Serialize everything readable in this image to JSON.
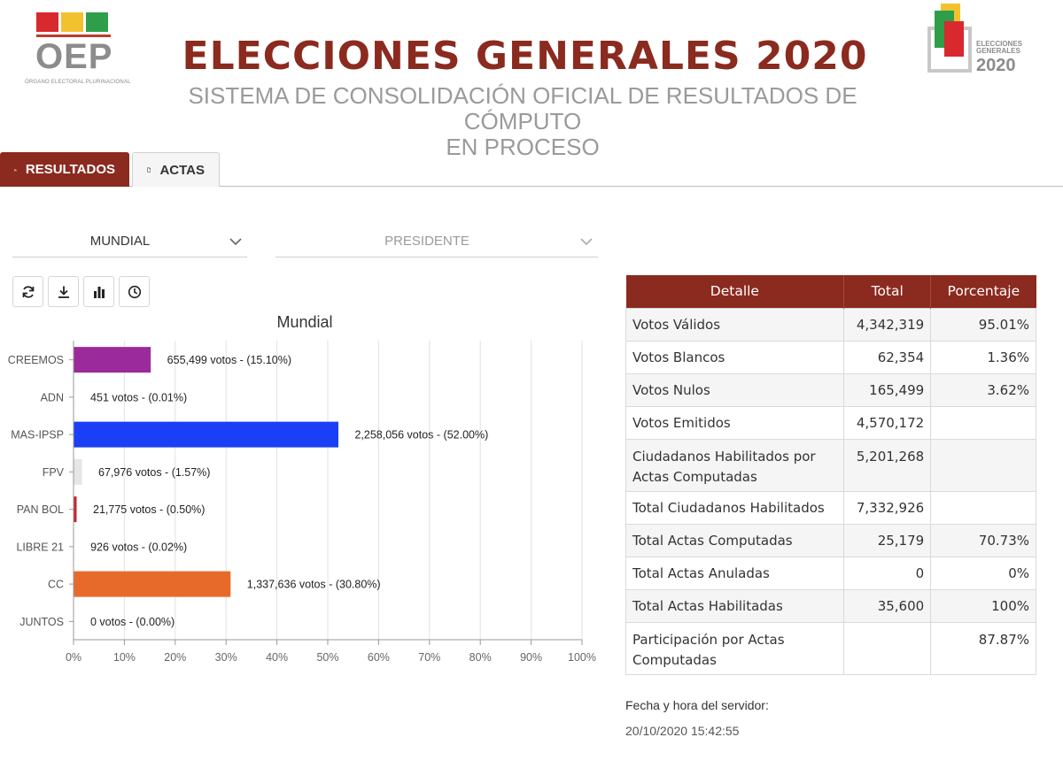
{
  "header": {
    "left_logo": {
      "text": "OEP",
      "subtext": "ÓRGANO ELECTORAL PLURINACIONAL",
      "colors": [
        "#d8292f",
        "#f2c12e",
        "#2e9e4a"
      ]
    },
    "title": "ELECCIONES GENERALES 2020",
    "subtitle_line1": "SISTEMA DE CONSOLIDACIÓN OFICIAL DE RESULTADOS DE CÓMPUTO",
    "subtitle_line2": "EN PROCESO",
    "right_logo": {
      "line1": "ELECCIONES",
      "line2": "GENERALES",
      "year": "2020"
    }
  },
  "tabs": [
    {
      "label": "RESULTADOS",
      "icon": "bar-chart-icon",
      "active": true
    },
    {
      "label": "ACTAS",
      "icon": "document-icon",
      "active": false
    }
  ],
  "filters": {
    "scope": "MUNDIAL",
    "election": "PRESIDENTE"
  },
  "toolbar": [
    "refresh-icon",
    "download-icon",
    "bar-chart-icon",
    "clock-icon"
  ],
  "chart_data": {
    "type": "bar",
    "orientation": "horizontal",
    "title": "Mundial",
    "categories": [
      "CREEMOS",
      "ADN",
      "MAS-IPSP",
      "FPV",
      "PAN BOL",
      "LIBRE 21",
      "CC",
      "JUNTOS"
    ],
    "values": [
      15.1,
      0.01,
      52.0,
      1.57,
      0.5,
      0.02,
      30.8,
      0.0
    ],
    "labels": [
      "655,499 votos - (15.10%)",
      "451 votos - (0.01%)",
      "2,258,056 votos - (52.00%)",
      "67,976 votos - (1.57%)",
      "21,775 votos - (0.50%)",
      "926 votos - (0.02%)",
      "1,337,636 votos - (30.80%)",
      "0 votos - (0.00%)"
    ],
    "colors": [
      "#9b2a9b",
      "#e6e6e6",
      "#1a3ff5",
      "#e6e6e6",
      "#c8242f",
      "#e6e6e6",
      "#e86a2a",
      "#e6e6e6"
    ],
    "xticks": [
      "0%",
      "10%",
      "20%",
      "30%",
      "40%",
      "50%",
      "60%",
      "70%",
      "80%",
      "90%",
      "100%"
    ],
    "xlim": [
      0,
      100
    ],
    "grid": true
  },
  "table": {
    "headers": [
      "Detalle",
      "Total",
      "Porcentaje"
    ],
    "rows": [
      {
        "label": "Votos Válidos",
        "total": "4,342,319",
        "percent": "95.01%"
      },
      {
        "label": "Votos Blancos",
        "total": "62,354",
        "percent": "1.36%"
      },
      {
        "label": "Votos Nulos",
        "total": "165,499",
        "percent": "3.62%"
      },
      {
        "label": "Votos Emitidos",
        "total": "4,570,172",
        "percent": ""
      },
      {
        "label": "Ciudadanos Habilitados por Actas Computadas",
        "total": "5,201,268",
        "percent": "",
        "tall": true
      },
      {
        "label": "Total Ciudadanos Habilitados",
        "total": "7,332,926",
        "percent": ""
      },
      {
        "label": "Total Actas Computadas",
        "total": "25,179",
        "percent": "70.73%"
      },
      {
        "label": "Total Actas Anuladas",
        "total": "0",
        "percent": "0%"
      },
      {
        "label": "Total Actas Habilitadas",
        "total": "35,600",
        "percent": "100%"
      },
      {
        "label": "Participación por Actas Computadas",
        "total": "",
        "percent": "87.87%",
        "tall": true
      }
    ]
  },
  "server": {
    "label": "Fecha y hora del servidor:",
    "datetime": "20/10/2020 15:42:55"
  },
  "accent_color": "#8b2a1f"
}
